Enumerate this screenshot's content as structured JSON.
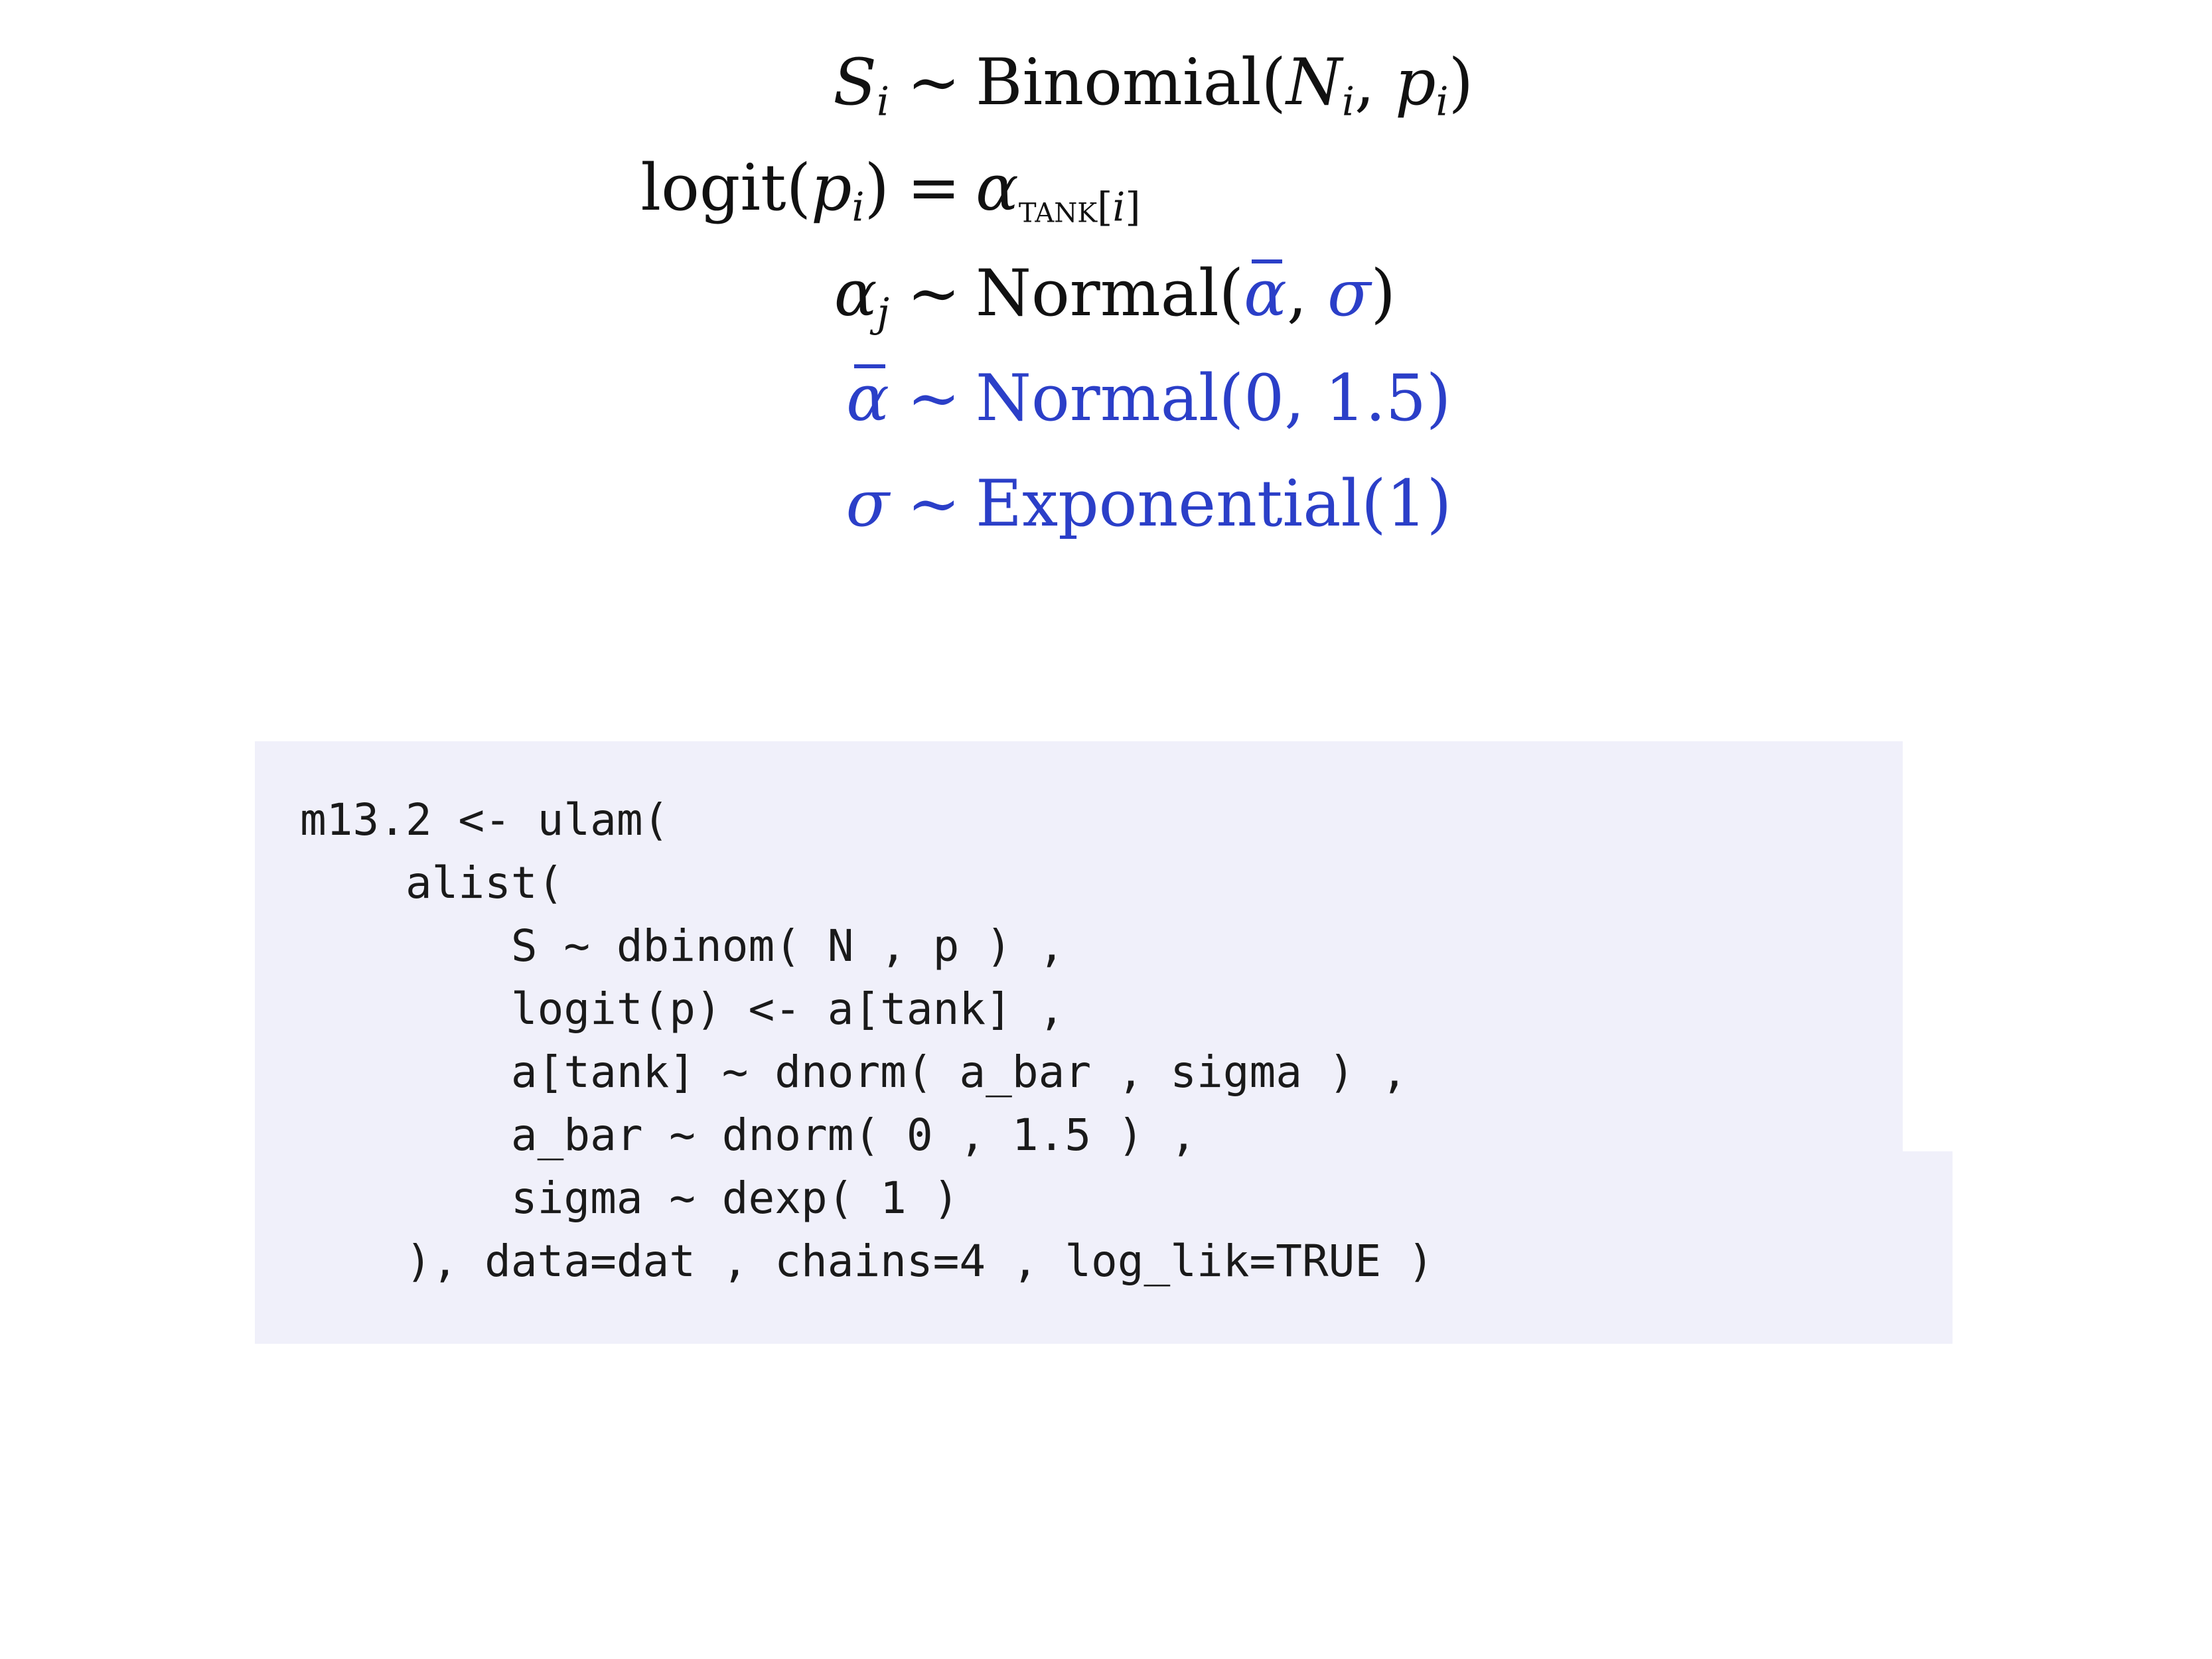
{
  "equations": [
    {
      "lhs": [
        {
          "t": "S",
          "it": true
        },
        {
          "t": "i",
          "it": true,
          "sub": true
        }
      ],
      "op": "∼",
      "rhs": [
        {
          "t": "Binomial("
        },
        {
          "t": "N",
          "it": true
        },
        {
          "t": "i",
          "it": true,
          "sub": true
        },
        {
          "t": ", "
        },
        {
          "t": "p",
          "it": true
        },
        {
          "t": "i",
          "it": true,
          "sub": true
        },
        {
          "t": ")"
        }
      ]
    },
    {
      "lhs": [
        {
          "t": "logit("
        },
        {
          "t": "p",
          "it": true
        },
        {
          "t": "i",
          "it": true,
          "sub": true
        },
        {
          "t": ")"
        }
      ],
      "op": "=",
      "rhs": [
        {
          "t": "α",
          "it": true
        },
        {
          "t": "tank",
          "sc": true
        },
        {
          "t": "[",
          "sub": true
        },
        {
          "t": "i",
          "it": true,
          "sub": true
        },
        {
          "t": "]",
          "sub": true
        }
      ]
    },
    {
      "lhs": [
        {
          "t": "α",
          "it": true
        },
        {
          "t": "j",
          "it": true,
          "sub": true
        }
      ],
      "op": "∼",
      "rhs": [
        {
          "t": "Normal("
        },
        {
          "t": "α",
          "it": true,
          "bar": true,
          "blue": true
        },
        {
          "t": ", "
        },
        {
          "t": "σ",
          "it": true,
          "blue": true
        },
        {
          "t": ")"
        }
      ]
    },
    {
      "blue": true,
      "lhs": [
        {
          "t": "α",
          "it": true,
          "bar": true
        }
      ],
      "op": "∼",
      "rhs": [
        {
          "t": "Normal(0, 1.5)"
        }
      ]
    },
    {
      "blue": true,
      "lhs": [
        {
          "t": "σ",
          "it": true
        }
      ],
      "op": "∼",
      "rhs": [
        {
          "t": "Exponential(1)"
        }
      ]
    }
  ],
  "code_lines": [
    "m13.2 <- ulam(",
    "    alist(",
    "        S ~ dbinom( N , p ) ,",
    "        logit(p) <- a[tank] ,",
    "        a[tank] ~ dnorm( a_bar , sigma ) ,",
    "        a_bar ~ dnorm( 0 , 1.5 ) ,",
    "        sigma ~ dexp( 1 )",
    "    ), data=dat , chains=4 , log_lik=TRUE )"
  ],
  "colors": {
    "highlight": "#2b3fc8",
    "code_background": "#f0f0fa",
    "text": "#111111"
  }
}
